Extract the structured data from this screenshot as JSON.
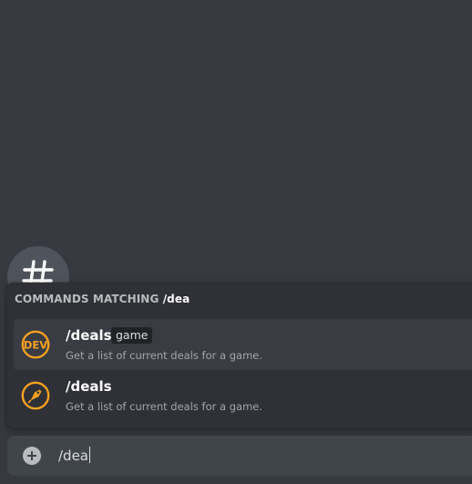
{
  "channel": {
    "icon": "hashtag-icon"
  },
  "autocomplete": {
    "header_prefix": "COMMANDS MATCHING",
    "header_query": "/dea",
    "commands": [
      {
        "name": "/deals",
        "option": "game",
        "description": "Get a list of current deals for a game.",
        "icon": "dev-badge-icon",
        "selected": true
      },
      {
        "name": "/deals",
        "option": "",
        "description": "Get a list of current deals for a game.",
        "icon": "price-tag-icon",
        "selected": false
      }
    ]
  },
  "composer": {
    "plus_icon": "plus-circle-icon",
    "value": "/dea"
  },
  "colors": {
    "background": "#36393f",
    "popout": "#2f3136",
    "selected_row": "#393c43",
    "input_bar": "#40444b",
    "icon_accent": "#f6a121"
  }
}
